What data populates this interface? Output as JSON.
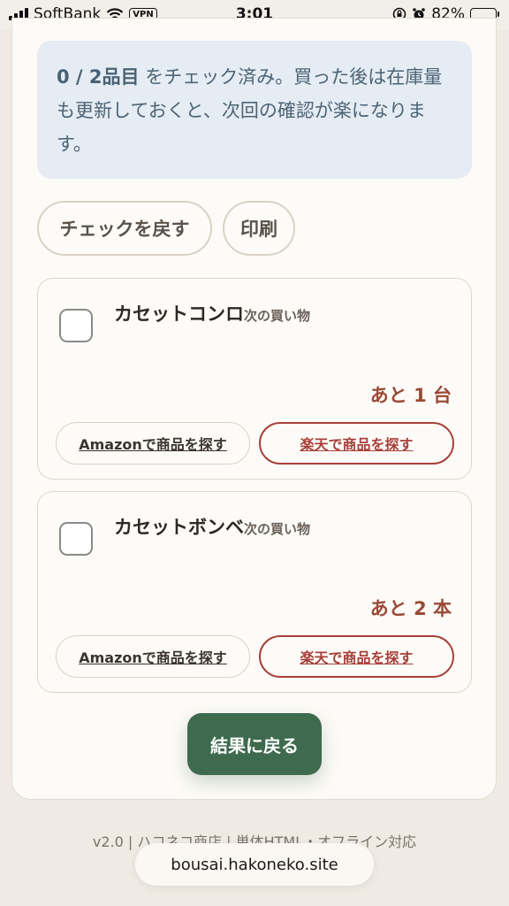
{
  "status_bar": {
    "carrier": "SoftBank",
    "vpn": "VPN",
    "time": "3:01",
    "battery": "82%",
    "battery_level": 0.82
  },
  "info": {
    "count": "0 / 2品目",
    "message": " をチェック済み。買った後は在庫量も更新しておくと、次回の確認が楽になります。"
  },
  "actions": {
    "uncheck": "チェックを戻す",
    "print": "印刷"
  },
  "items": [
    {
      "name": "カセットコンロ",
      "tag": "次の買い物",
      "remaining": "あと 1 台",
      "amazon": "Amazonで商品を探す",
      "rakuten": "楽天で商品を探す",
      "checked": false
    },
    {
      "name": "カセットボンベ",
      "tag": "次の買い物",
      "remaining": "あと 2 本",
      "amazon": "Amazonで商品を探す",
      "rakuten": "楽天で商品を探す",
      "checked": false
    }
  ],
  "back_button": "結果に戻る",
  "footer": "v2.0 | ハコネコ商店 | 単体HTML・オフライン対応",
  "url": "bousai.hakoneko.site"
}
